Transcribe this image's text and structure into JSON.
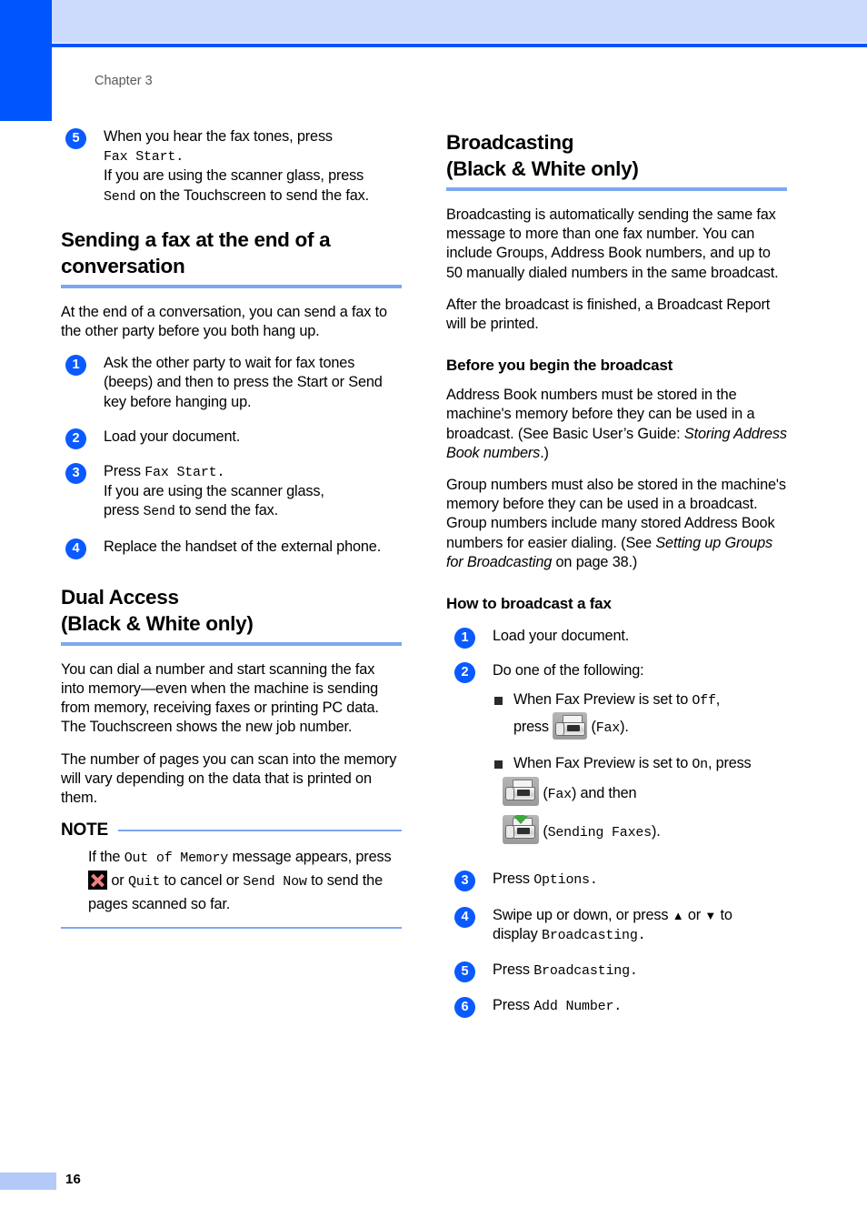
{
  "page": {
    "chapter_label": "Chapter 3",
    "page_number": "16",
    "accent_blue": "#0055FF",
    "rule_blue": "#7DA7F0",
    "header_band": "#CCDBFB"
  },
  "left_column": {
    "step5": {
      "num": "5",
      "line1": "When you hear the fax tones, press",
      "mono1": "Fax Start.",
      "line2": "If you are using the scanner glass, press",
      "mono2": "Send",
      "line3": " on the Touchscreen to send the fax."
    },
    "section1": {
      "heading_line1": "Sending a fax at the end of a",
      "heading_line2": "conversation",
      "intro": "At the end of a conversation, you can send a fax to the other party before you both hang up.",
      "steps": [
        {
          "num": "1",
          "text": "Ask the other party to wait for fax tones (beeps) and then to press the Start or Send key before hanging up."
        },
        {
          "num": "2",
          "text": "Load your document."
        },
        {
          "num": "4",
          "text": "Replace the handset of the external phone."
        }
      ],
      "step3": {
        "num": "3",
        "pre": "Press ",
        "mono1": "Fax Start.",
        "line2": "If you are using the scanner glass,",
        "line3_pre": "press ",
        "mono2": "Send",
        "line3_post": " to send the fax."
      }
    },
    "section2": {
      "heading_line1": "Dual Access",
      "heading_line2": "(Black & White only)",
      "para1": "You can dial a number and start scanning the fax into memory—even when the machine is sending from memory, receiving faxes or printing PC data. The Touchscreen shows the new job number.",
      "para2": "The number of pages you can scan into the memory will vary depending on the data that is printed on them."
    },
    "note": {
      "title": "NOTE",
      "seg1": "If the ",
      "mono1": "Out of Memory",
      "seg2": " message appears, press ",
      "icon": "cancel-x-icon",
      "seg3": " or ",
      "mono2": "Quit",
      "seg4": " to cancel or ",
      "mono3": "Send Now",
      "seg5": " to send the pages scanned so far."
    }
  },
  "right_column": {
    "section": {
      "heading_line1": "Broadcasting",
      "heading_line2": "(Black & White only)",
      "para1": "Broadcasting is automatically sending the same fax message to more than one fax number. You can include Groups, Address Book numbers, and up to 50 manually dialed numbers in the same broadcast.",
      "para2": "After the broadcast is finished, a Broadcast Report will be printed."
    },
    "before": {
      "heading": "Before you begin the broadcast",
      "para1_pre": "Address Book numbers must be stored in the machine's memory before they can be used in a broadcast. (See Basic User’s Guide: ",
      "para1_italic": "Storing Address Book numbers",
      "para1_post": ".)",
      "para2_pre": "Group numbers must also be stored in the machine's memory before they can be used in a broadcast. Group numbers include many stored Address Book numbers for easier dialing. (See ",
      "para2_italic": "Setting up Groups for Broadcasting",
      "para2_post": " on page 38.)"
    },
    "howto": {
      "heading": "How to broadcast a fax",
      "step1": {
        "num": "1",
        "text": "Load your document."
      },
      "step2": {
        "num": "2",
        "text": "Do one of the following:",
        "bullet1_pre": "When Fax Preview is set to ",
        "bullet1_mono": "Off",
        "bullet1_comma": ",",
        "bullet1_press": "press ",
        "bullet1_icon": "fax-icon",
        "bullet1_post_open": "(",
        "bullet1_label": "Fax",
        "bullet1_post_close": ").",
        "bullet2_pre": "When Fax Preview is set to ",
        "bullet2_mono": "On",
        "bullet2_post": ", press",
        "bullet2_icon1": "fax-icon",
        "bullet2_label1": "Fax",
        "bullet2_mid": " and then",
        "bullet2_icon2": "sending-faxes-icon",
        "bullet2_label2": "Sending Faxes",
        "bullet2_end": ")."
      },
      "step3": {
        "num": "3",
        "pre": "Press ",
        "mono": "Options."
      },
      "step4": {
        "num": "4",
        "line1": "Swipe up or down, or press ",
        "up_arrow": "▲",
        "or": " or ",
        "down_arrow": "▼",
        "line1_end": " to",
        "line2_pre": "display ",
        "line2_mono": "Broadcasting."
      },
      "step5": {
        "num": "5",
        "pre": "Press ",
        "mono": "Broadcasting."
      },
      "step6": {
        "num": "6",
        "pre": "Press ",
        "mono": "Add Number."
      }
    }
  }
}
